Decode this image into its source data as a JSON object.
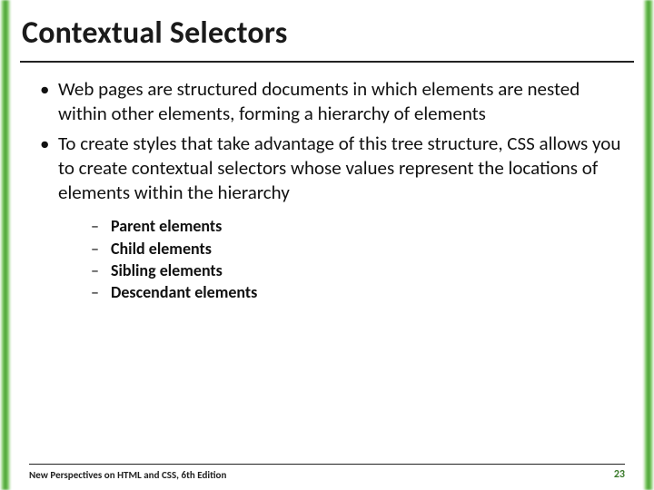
{
  "title": "Contextual Selectors",
  "bullets": [
    "Web pages are structured documents in which elements are nested within other elements,  forming a hierarchy of elements",
    "To create styles that take advantage of this tree structure, CSS allows you to create contextual selectors whose values represent the locations of elements within the hierarchy"
  ],
  "sub_bullets": [
    "Parent elements",
    "Child elements",
    "Sibling elements",
    "Descendant elements"
  ],
  "footer": {
    "text": "New Perspectives on HTML and CSS, 6th Edition",
    "page": "23"
  }
}
